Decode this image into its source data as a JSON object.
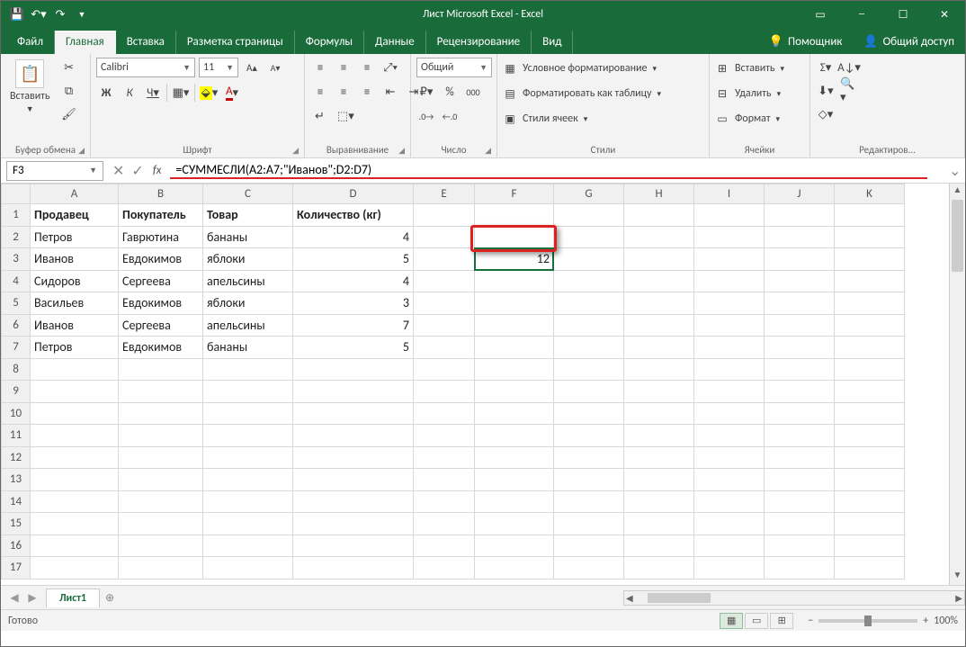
{
  "window": {
    "title": "Лист Microsoft Excel - Excel"
  },
  "qat": {
    "save": "save-icon",
    "undo": "undo-icon",
    "redo": "redo-icon"
  },
  "tabs": {
    "items": [
      "Файл",
      "Главная",
      "Вставка",
      "Разметка страницы",
      "Формулы",
      "Данные",
      "Рецензирование",
      "Вид"
    ],
    "active_index": 1,
    "helper": "Помощник",
    "share": "Общий доступ"
  },
  "ribbon": {
    "clipboard": {
      "label": "Буфер обмена",
      "paste": "Вставить"
    },
    "font": {
      "label": "Шрифт",
      "name": "Calibri",
      "size": "11",
      "bold": "Ж",
      "italic": "К",
      "underline": "Ч"
    },
    "alignment": {
      "label": "Выравнивание"
    },
    "number": {
      "label": "Число",
      "format": "Общий"
    },
    "styles": {
      "label": "Стили",
      "cond": "Условное форматирование",
      "table": "Форматировать как таблицу",
      "cell": "Стили ячеек"
    },
    "cells": {
      "label": "Ячейки",
      "insert": "Вставить",
      "delete": "Удалить",
      "format": "Формат"
    },
    "editing": {
      "label": "Редактиров..."
    }
  },
  "formula_bar": {
    "namebox": "F3",
    "formula": "=СУММЕСЛИ(A2:A7;\"Иванов\";D2:D7)"
  },
  "grid": {
    "columns": [
      "A",
      "B",
      "C",
      "D",
      "E",
      "F",
      "G",
      "H",
      "I",
      "J",
      "K"
    ],
    "rows": [
      1,
      2,
      3,
      4,
      5,
      6,
      7,
      8,
      9,
      10,
      11,
      12,
      13,
      14,
      15,
      16,
      17
    ],
    "headers": {
      "A": "Продавец",
      "B": "Покупатель",
      "C": "Товар",
      "D": "Количество (кг)"
    },
    "data": [
      {
        "A": "Петров",
        "B": "Гаврютина",
        "C": "бананы",
        "D": 4
      },
      {
        "A": "Иванов",
        "B": "Евдокимов",
        "C": "яблоки",
        "D": 5
      },
      {
        "A": "Сидоров",
        "B": "Сергеева",
        "C": "апельсины",
        "D": 4
      },
      {
        "A": "Васильев",
        "B": "Евдокимов",
        "C": "яблоки",
        "D": 3
      },
      {
        "A": "Иванов",
        "B": "Сергеева",
        "C": "апельсины",
        "D": 7
      },
      {
        "A": "Петров",
        "B": "Евдокимов",
        "C": "бананы",
        "D": 5
      }
    ],
    "active_cell": {
      "col": "F",
      "row": 3,
      "value": "12"
    }
  },
  "sheets": {
    "active": "Лист1"
  },
  "status": {
    "ready": "Готово",
    "zoom": "100%"
  }
}
